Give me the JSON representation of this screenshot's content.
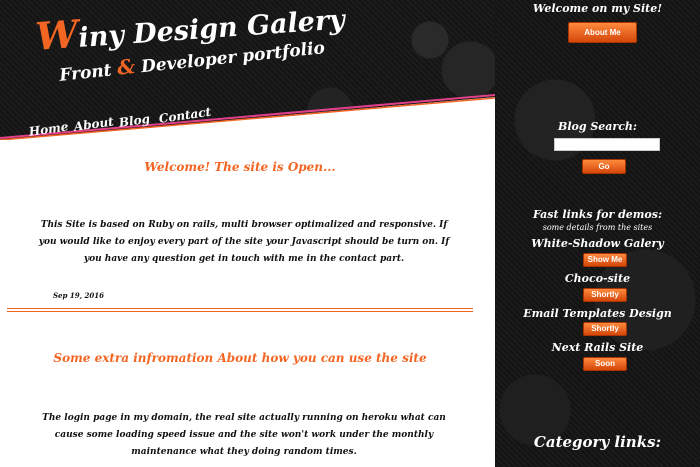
{
  "header": {
    "title_initial": "W",
    "title_rest": "iny Design Galery",
    "subtitle_part1": "Front ",
    "subtitle_amp": "&",
    "subtitle_part2": " Developer portfolio"
  },
  "nav": {
    "items": [
      {
        "label": "Home"
      },
      {
        "label": "About"
      },
      {
        "label": "Blog"
      },
      {
        "label": "Contact"
      }
    ]
  },
  "sidebar": {
    "welcome_heading": "Welcome on my Site!",
    "about_button": "About Me",
    "search_heading": "Blog Search:",
    "search_value": "",
    "search_button": "Go",
    "fast_links_heading": "Fast links for demos:",
    "fast_links_sub": "some details from the sites",
    "demos": [
      {
        "name": "White-Shadow Galery",
        "button": "Show Me"
      },
      {
        "name": "Choco-site",
        "button": "Shortly"
      },
      {
        "name": "Email Templates Design",
        "button": "Shortly"
      },
      {
        "name": "Next Rails Site",
        "button": "Soon"
      }
    ],
    "category_heading": "Category links:"
  },
  "posts": [
    {
      "title": "Welcome! The site is Open...",
      "body": "This Site is based on Ruby on rails, multi browser optimalized and responsive. If you would like to enjoy every part of the site your Javascript should be turn on. If you have any question get in touch with me in the contact part.",
      "date": "Sep 19, 2016"
    },
    {
      "title": "Some extra infromation About how you can use the site",
      "body": "The login page in my domain, the real site actually running on heroku what can cause some loading speed issue and the site won't work under the monthly maintenance what they doing random times."
    }
  ],
  "colors": {
    "accent": "#f26522",
    "dark_bg": "#161616",
    "stripe_pink": "#e0408a"
  }
}
